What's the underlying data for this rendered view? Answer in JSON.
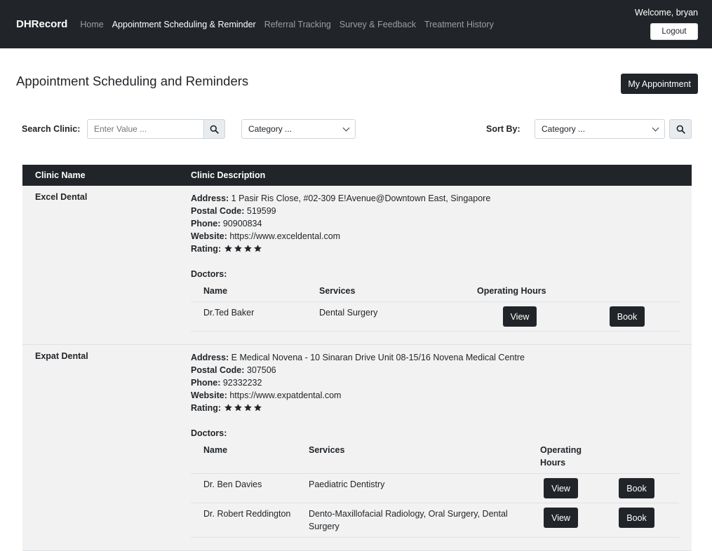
{
  "nav": {
    "brand": "DHRecord",
    "links": [
      "Home",
      "Appointment Scheduling & Reminder",
      "Referral Tracking",
      "Survey & Feedback",
      "Treatment History"
    ],
    "active_index": 1,
    "welcome": "Welcome, bryan",
    "logout": "Logout"
  },
  "header": {
    "title": "Appointment Scheduling and Reminders",
    "my_appointment": "My Appointment"
  },
  "filters": {
    "search_label": "Search Clinic:",
    "search_placeholder": "Enter Value ...",
    "category_select": "Category ...",
    "sort_label": "Sort By:",
    "sort_select": "Category ..."
  },
  "table": {
    "col_name": "Clinic Name",
    "col_desc": "Clinic Description",
    "clinics": [
      {
        "name": "Excel Dental",
        "address_label": "Address:",
        "address": "1 Pasir Ris Close, #02-309 E!Avenue@Downtown East, Singapore",
        "postal_label": "Postal Code:",
        "postal": "519599",
        "phone_label": "Phone:",
        "phone": "90900834",
        "website_label": "Website:",
        "website": "https://www.exceldental.com",
        "rating_label": "Rating:",
        "rating": 4,
        "doctors_label": "Doctors:",
        "doc_headers": [
          "Name",
          "Services",
          "Operating Hours"
        ],
        "doctors": [
          {
            "name": "Dr.Ted Baker",
            "services": "Dental Surgery",
            "view": "View",
            "book": "Book"
          }
        ]
      },
      {
        "name": "Expat Dental",
        "address_label": "Address:",
        "address": "E Medical Novena - 10 Sinaran Drive Unit 08-15/16 Novena Medical Centre",
        "postal_label": "Postal Code:",
        "postal": "307506",
        "phone_label": "Phone:",
        "phone": "92332232",
        "website_label": "Website:",
        "website": "https://www.expatdental.com",
        "rating_label": "Rating:",
        "rating": 4,
        "doctors_label": "Doctors:",
        "doc_headers": [
          "Name",
          "Services",
          "Operating Hours"
        ],
        "doctors": [
          {
            "name": "Dr. Ben Davies",
            "services": "Paediatric Dentistry",
            "view": "View",
            "book": "Book"
          },
          {
            "name": "Dr. Robert Reddington",
            "services": "Dento-Maxillofacial Radiology, Oral Surgery, Dental Surgery",
            "view": "View",
            "book": "Book"
          }
        ]
      }
    ]
  }
}
